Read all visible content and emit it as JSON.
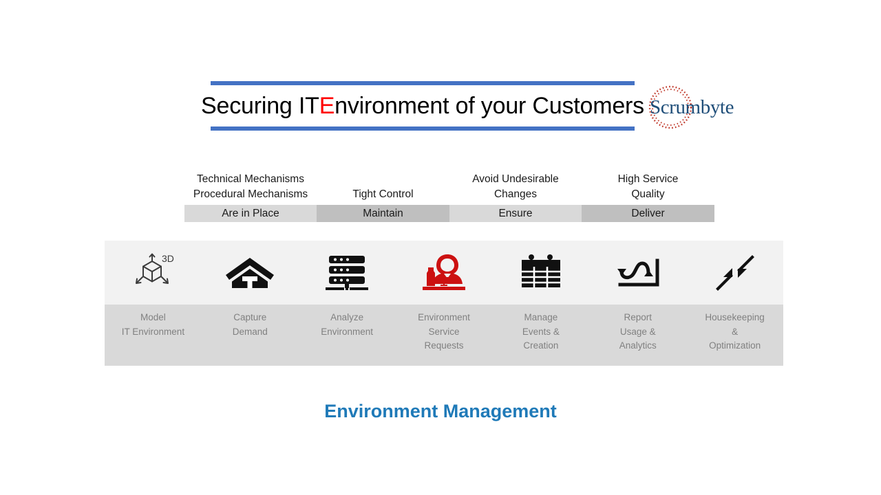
{
  "banner": {
    "title_pre": "Securing IT ",
    "title_highlight": "E",
    "title_post": "nvironment of your Customers",
    "rule_color": "#4472C4",
    "highlight_color": "#FF0000"
  },
  "logo": {
    "text": "Scrumbyte",
    "text_color": "#1F4E79",
    "ring_color": "#C0392B"
  },
  "outcomes": [
    {
      "head_line1": "Technical Mechanisms",
      "head_line2": "Procedural Mechanisms",
      "bar": "Are in Place",
      "tone": "light"
    },
    {
      "head_line1": "",
      "head_line2": "Tight Control",
      "bar": "Maintain",
      "tone": "dark"
    },
    {
      "head_line1": "Avoid Undesirable",
      "head_line2": "Changes",
      "bar": "Ensure",
      "tone": "light"
    },
    {
      "head_line1": "High Service",
      "head_line2": "Quality",
      "bar": "Deliver",
      "tone": "dark"
    }
  ],
  "capabilities": [
    {
      "icon": "3d-cube-icon",
      "label_line1": "Model",
      "label_line2": "IT Environment",
      "label_line3": ""
    },
    {
      "icon": "house-icon",
      "label_line1": "Capture",
      "label_line2": "Demand",
      "label_line3": ""
    },
    {
      "icon": "server-stack-icon",
      "label_line1": "Analyze",
      "label_line2": "Environment",
      "label_line3": ""
    },
    {
      "icon": "service-person-icon",
      "label_line1": "Environment",
      "label_line2": "Service",
      "label_line3": "Requests"
    },
    {
      "icon": "calendar-icon",
      "label_line1": "Manage",
      "label_line2": "Events &",
      "label_line3": "Creation"
    },
    {
      "icon": "line-chart-icon",
      "label_line1": "Report",
      "label_line2": "Usage &",
      "label_line3": "Analytics"
    },
    {
      "icon": "compress-arrows-icon",
      "label_line1": "Housekeeping",
      "label_line2": "&",
      "label_line3": "Optimization"
    }
  ],
  "footer": {
    "title": "Environment Management",
    "title_color": "#1F7AB8"
  }
}
